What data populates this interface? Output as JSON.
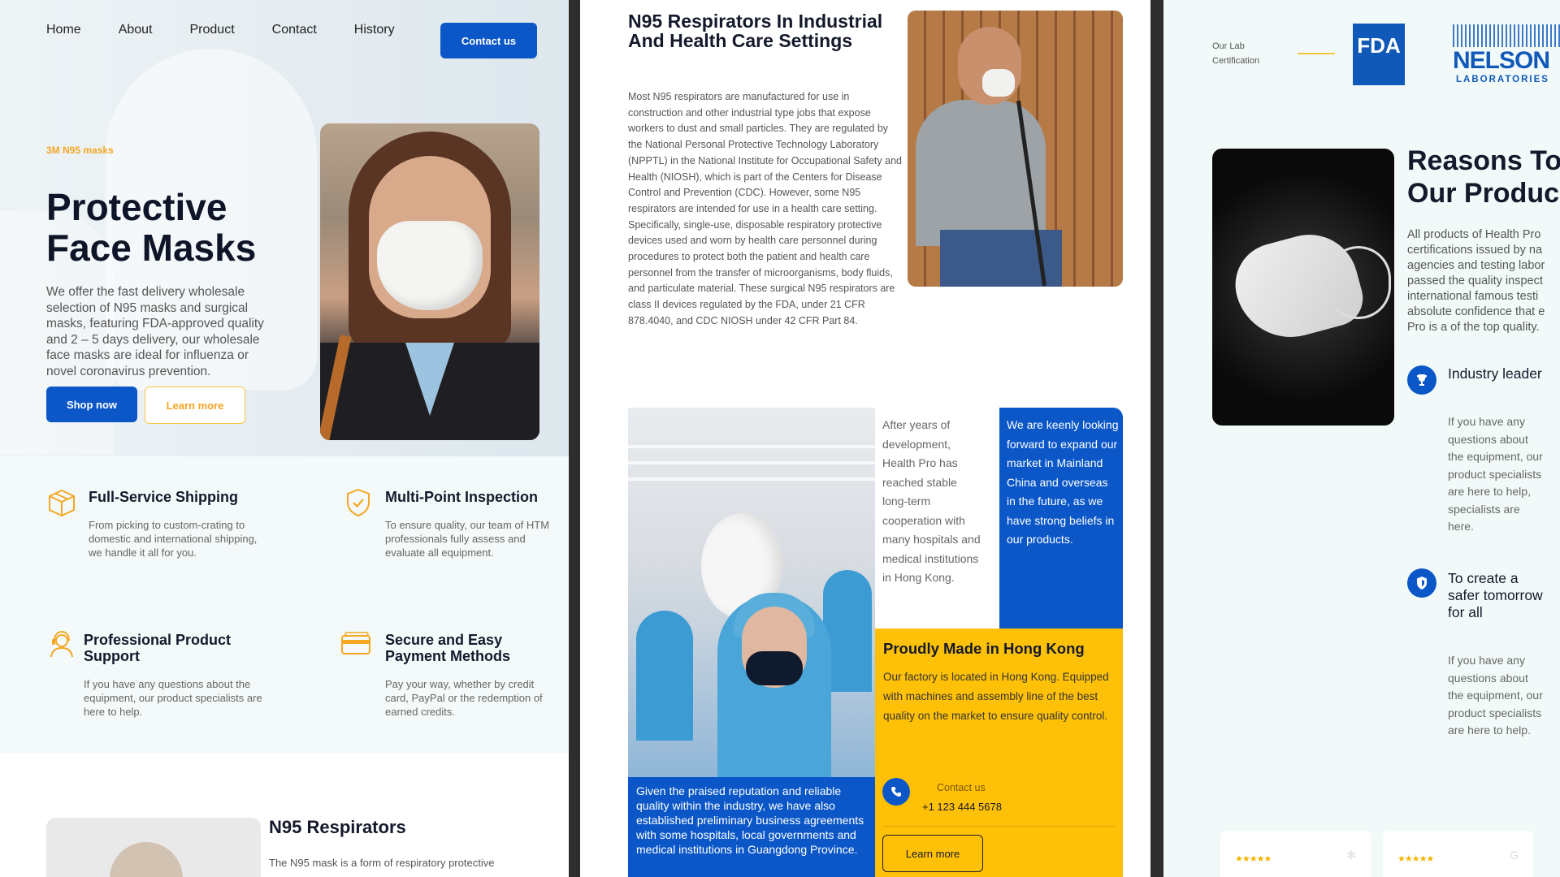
{
  "panel1": {
    "nav": {
      "items": [
        "Home",
        "About",
        "Product",
        "Contact",
        "History"
      ],
      "cta": "Contact us"
    },
    "hero": {
      "eyebrow": "3M N95 masks",
      "title": "Protective Face Masks",
      "text": "We offer the fast delivery wholesale selection of N95 masks and surgical masks, featuring FDA-approved quality and 2 – 5 days delivery, our wholesale face masks are ideal for influenza or novel coronavirus prevention.",
      "shop": "Shop now",
      "learn": "Learn more"
    },
    "features": [
      {
        "title": "Full-Service Shipping",
        "text": "From picking to custom-crating to domestic and international shipping, we handle it all for you.",
        "icon": "box-icon"
      },
      {
        "title": "Multi-Point Inspection",
        "text": "To ensure quality, our team of HTM professionals fully assess and evaluate all equipment.",
        "icon": "shield-check-icon"
      },
      {
        "title": "Professional Product Support",
        "text": "If you have any questions about the equipment, our product specialists are here to help.",
        "icon": "support-agent-icon"
      },
      {
        "title": "Secure and Easy Payment Methods",
        "text": "Pay your way, whether by credit card, PayPal or the redemption of earned credits.",
        "icon": "credit-card-icon"
      }
    ],
    "n95": {
      "title": "N95 Respirators",
      "text": "The N95 mask is a form of respiratory protective"
    }
  },
  "panel2": {
    "title": "N95 Respirators In Industrial And Health Care Settings",
    "text": "Most N95 respirators are manufactured for use in construction and other industrial type jobs that expose workers to dust and small particles. They are regulated by the National Personal Protective Technology Laboratory (NPPTL) in the National Institute for Occupational Safety and Health (NIOSH), which is part of the Centers for Disease Control and Prevention (CDC). However, some N95 respirators are intended for use in a health care setting. Specifically, single-use, disposable respiratory protective devices used and worn by health care personnel during procedures to protect both the patient and health care personnel from the transfer of microorganisms, body fluids, and particulate material. These surgical N95 respirators are class II devices regulated by the FDA, under 21 CFR 878.4040, and CDC NIOSH under 42 CFR Part 84.",
    "side_text": "After years of development, Health Pro has reached stable long-term cooperation with many hospitals and medical institutions in Hong Kong.",
    "blue_text": "We are keenly looking forward to expand our market in Mainland China and overseas in the future, as we have strong beliefs in our products.",
    "caption": "Given the praised reputation and reliable quality within the industry, we have also established preliminary business agreements with some hospitals, local governments and medical institutions in Guangdong Province.",
    "made": {
      "title": "Proudly Made in Hong Kong",
      "text": "Our factory is located in Hong Kong. Equipped with machines and assembly line of the best quality on the market to ensure quality control.",
      "contact_label": "Contact us",
      "phone": "+1 123 444 5678",
      "learn": "Learn more"
    }
  },
  "panel3": {
    "lab_cert": "Our Lab Certification",
    "fda": "FDA",
    "nelson": "NELSON",
    "laboratories": "LABORATORIES",
    "title_line1": "Reasons To",
    "title_line2": "Our Produc",
    "text_lines": [
      "All products of Health Pro",
      "certifications issued by na",
      "agencies and testing labor",
      "passed the quality inspect",
      "international famous testi",
      "absolute confidence that e",
      "Pro is a of the top quality."
    ],
    "reasons": [
      {
        "title": "Industry leader",
        "text": "If you have any questions about the equipment, our product specialists are here to help, specialists are here.",
        "icon": "trophy-icon"
      },
      {
        "title": "To create a safer tomorrow for all",
        "text": "If you have any questions about the equipment, our product specialists are here to help.",
        "icon": "shield-icon"
      }
    ],
    "reviews": [
      {
        "stars": "★★★★★"
      },
      {
        "stars": "★★★★★"
      }
    ]
  },
  "colors": {
    "primary": "#0b57c8",
    "accent": "#ffc107",
    "eyebrow": "#f5a623",
    "dark": "#14192b"
  }
}
